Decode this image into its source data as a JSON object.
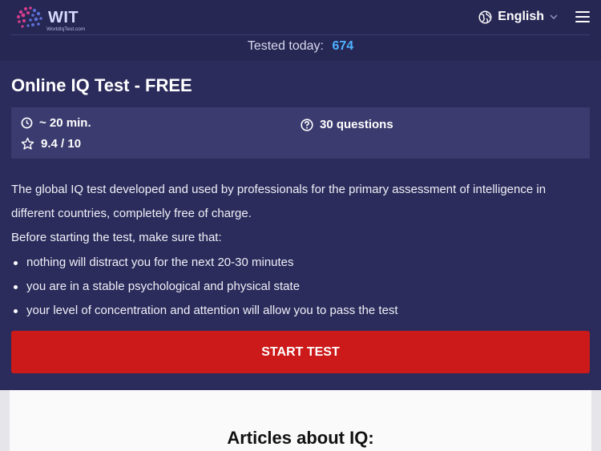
{
  "header": {
    "logo_text": "WIT",
    "logo_subtext": "WorldIqTest.com",
    "language": "English"
  },
  "stats": {
    "tested_label": "Tested today:",
    "tested_count": "674"
  },
  "test": {
    "title": "Online IQ Test - FREE",
    "duration": "~ 20 min.",
    "questions": "30 questions",
    "rating": "9.4 / 10",
    "description": "The global IQ test developed and used by professionals for the primary assessment of intelligence in different countries, completely free of charge.",
    "before_label": "Before starting the test, make sure that:",
    "bullets": [
      "nothing will distract you for the next 20-30 minutes",
      "you are in a stable psychological and physical state",
      "your level of concentration and attention will allow you to pass the test"
    ],
    "start_button": "START TEST"
  },
  "articles": {
    "title": "Articles about IQ:"
  },
  "colors": {
    "background": "#272754",
    "accent_blue": "#4fb3ff",
    "button_red": "#cc1a1a"
  }
}
